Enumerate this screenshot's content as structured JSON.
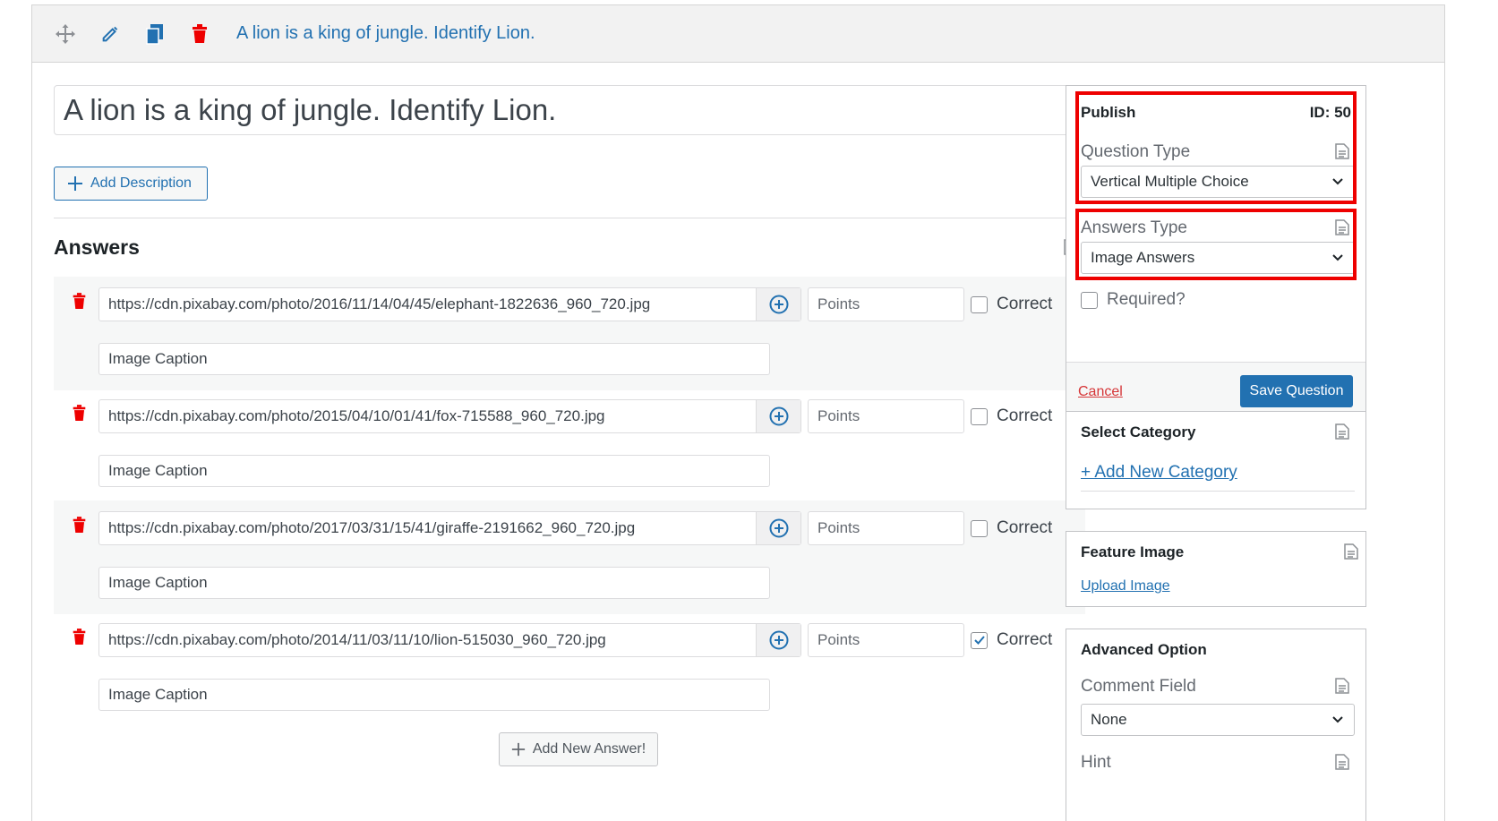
{
  "toolbar": {
    "title": "A lion is a king of jungle. Identify Lion.",
    "icons": [
      "move-icon",
      "edit-icon",
      "duplicate-icon",
      "trash-icon"
    ]
  },
  "question": {
    "title_value": "A lion is a king of jungle. Identify Lion.",
    "add_description_label": "Add Description"
  },
  "answers": {
    "heading": "Answers",
    "items": [
      {
        "url": "https://cdn.pixabay.com/photo/2016/11/14/04/45/elephant-1822636_960_720.jpg",
        "points_placeholder": "Points",
        "caption_placeholder": "Image Caption",
        "correct_label": "Correct",
        "correct": false
      },
      {
        "url": "https://cdn.pixabay.com/photo/2015/04/10/01/41/fox-715588_960_720.jpg",
        "points_placeholder": "Points",
        "caption_placeholder": "Image Caption",
        "correct_label": "Correct",
        "correct": false
      },
      {
        "url": "https://cdn.pixabay.com/photo/2017/03/31/15/41/giraffe-2191662_960_720.jpg",
        "points_placeholder": "Points",
        "caption_placeholder": "Image Caption",
        "correct_label": "Correct",
        "correct": false
      },
      {
        "url": "https://cdn.pixabay.com/photo/2014/11/03/11/10/lion-515030_960_720.jpg",
        "points_placeholder": "Points",
        "caption_placeholder": "Image Caption",
        "correct_label": "Correct",
        "correct": true
      }
    ],
    "add_new_label": "Add New Answer!"
  },
  "publish": {
    "heading": "Publish",
    "id_label": "ID: 50",
    "question_type_label": "Question Type",
    "question_type_value": "Vertical Multiple Choice",
    "answers_type_label": "Answers Type",
    "answers_type_value": "Image Answers",
    "required_label": "Required?",
    "cancel_label": "Cancel",
    "save_label": "Save Question"
  },
  "category": {
    "heading": "Select Category",
    "add_link": "+ Add New Category"
  },
  "feature_image": {
    "heading": "Feature Image",
    "upload_link": "Upload Image"
  },
  "advanced": {
    "heading": "Advanced Option",
    "comment_label": "Comment Field",
    "comment_value": "None",
    "hint_label": "Hint"
  },
  "colors": {
    "accent": "#2271b1",
    "danger": "#d63638",
    "highlight": "#ee0000"
  }
}
